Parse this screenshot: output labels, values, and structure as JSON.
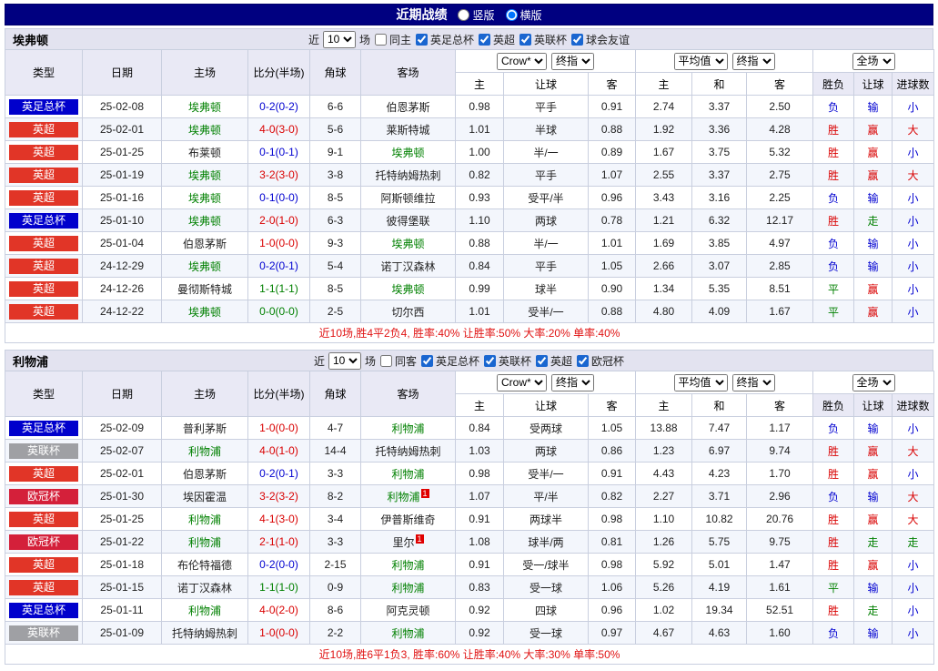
{
  "topbar": {
    "title": "近期战绩",
    "layout_options": [
      {
        "label": "竖版",
        "selected": false
      },
      {
        "label": "横版",
        "selected": true
      }
    ]
  },
  "filter_labels": {
    "recent_prefix": "近",
    "recent_count": "10",
    "recent_suffix": "场"
  },
  "selectors": {
    "bookmaker": "Crow*",
    "bookmaker_stage": "终指",
    "average": "平均值",
    "average_stage": "终指",
    "scope": "全场"
  },
  "columns": {
    "type": "类型",
    "date": "日期",
    "home": "主场",
    "score": "比分(半场)",
    "corner": "角球",
    "away": "客场",
    "hcp_home": "主",
    "hcp_line": "让球",
    "hcp_away": "客",
    "avg_home": "主",
    "avg_draw": "和",
    "avg_away": "客",
    "res_wdl": "胜负",
    "res_hcp": "让球",
    "res_goals": "进球数"
  },
  "colors": {
    "navy": "#000080",
    "red": "#D90000",
    "blue": "#0000D0",
    "green": "#008000",
    "summary": "#E01212",
    "comp": {
      "英足总杯": "#0000CC",
      "英超": "#E13527",
      "英联杯": "#9FA0A4",
      "欧冠杯": "#D4203A",
      "球会友谊": "#55AA55"
    }
  },
  "sections": [
    {
      "team": "埃弗顿",
      "same_side_label": "同主",
      "same_side_checked": false,
      "competitions": [
        {
          "label": "英足总杯",
          "checked": true
        },
        {
          "label": "英超",
          "checked": true
        },
        {
          "label": "英联杯",
          "checked": true
        },
        {
          "label": "球会友谊",
          "checked": true
        }
      ],
      "rows": [
        {
          "comp": "英足总杯",
          "date": "25-02-08",
          "home": "埃弗顿",
          "home_focus": true,
          "score": "0-2(0-2)",
          "score_color": "blue",
          "corner": "6-6",
          "away": "伯恩茅斯",
          "hcp": [
            "0.98",
            "平手",
            "0.91"
          ],
          "avg": [
            "2.74",
            "3.37",
            "2.50"
          ],
          "res": [
            [
              "负",
              "blue"
            ],
            [
              "输",
              "blue"
            ],
            [
              "小",
              "blue"
            ]
          ]
        },
        {
          "comp": "英超",
          "date": "25-02-01",
          "home": "埃弗顿",
          "home_focus": true,
          "score": "4-0(3-0)",
          "score_color": "red",
          "corner": "5-6",
          "away": "莱斯特城",
          "hcp": [
            "1.01",
            "半球",
            "0.88"
          ],
          "avg": [
            "1.92",
            "3.36",
            "4.28"
          ],
          "res": [
            [
              "胜",
              "red"
            ],
            [
              "赢",
              "red"
            ],
            [
              "大",
              "red"
            ]
          ]
        },
        {
          "comp": "英超",
          "date": "25-01-25",
          "home": "布莱顿",
          "score": "0-1(0-1)",
          "score_color": "blue",
          "corner": "9-1",
          "away": "埃弗顿",
          "away_focus": true,
          "hcp": [
            "1.00",
            "半/一",
            "0.89"
          ],
          "avg": [
            "1.67",
            "3.75",
            "5.32"
          ],
          "res": [
            [
              "胜",
              "red"
            ],
            [
              "赢",
              "red"
            ],
            [
              "小",
              "blue"
            ]
          ]
        },
        {
          "comp": "英超",
          "date": "25-01-19",
          "home": "埃弗顿",
          "home_focus": true,
          "score": "3-2(3-0)",
          "score_color": "red",
          "corner": "3-8",
          "away": "托特纳姆热刺",
          "hcp": [
            "0.82",
            "平手",
            "1.07"
          ],
          "avg": [
            "2.55",
            "3.37",
            "2.75"
          ],
          "res": [
            [
              "胜",
              "red"
            ],
            [
              "赢",
              "red"
            ],
            [
              "大",
              "red"
            ]
          ]
        },
        {
          "comp": "英超",
          "date": "25-01-16",
          "home": "埃弗顿",
          "home_focus": true,
          "score": "0-1(0-0)",
          "score_color": "blue",
          "corner": "8-5",
          "away": "阿斯顿维拉",
          "hcp": [
            "0.93",
            "受平/半",
            "0.96"
          ],
          "avg": [
            "3.43",
            "3.16",
            "2.25"
          ],
          "res": [
            [
              "负",
              "blue"
            ],
            [
              "输",
              "blue"
            ],
            [
              "小",
              "blue"
            ]
          ]
        },
        {
          "comp": "英足总杯",
          "date": "25-01-10",
          "home": "埃弗顿",
          "home_focus": true,
          "score": "2-0(1-0)",
          "score_color": "red",
          "corner": "6-3",
          "away": "彼得堡联",
          "hcp": [
            "1.10",
            "两球",
            "0.78"
          ],
          "avg": [
            "1.21",
            "6.32",
            "12.17"
          ],
          "res": [
            [
              "胜",
              "red"
            ],
            [
              "走",
              "green"
            ],
            [
              "小",
              "blue"
            ]
          ]
        },
        {
          "comp": "英超",
          "date": "25-01-04",
          "home": "伯恩茅斯",
          "score": "1-0(0-0)",
          "score_color": "red",
          "corner": "9-3",
          "away": "埃弗顿",
          "away_focus": true,
          "hcp": [
            "0.88",
            "半/一",
            "1.01"
          ],
          "avg": [
            "1.69",
            "3.85",
            "4.97"
          ],
          "res": [
            [
              "负",
              "blue"
            ],
            [
              "输",
              "blue"
            ],
            [
              "小",
              "blue"
            ]
          ]
        },
        {
          "comp": "英超",
          "date": "24-12-29",
          "home": "埃弗顿",
          "home_focus": true,
          "score": "0-2(0-1)",
          "score_color": "blue",
          "corner": "5-4",
          "away": "诺丁汉森林",
          "hcp": [
            "0.84",
            "平手",
            "1.05"
          ],
          "avg": [
            "2.66",
            "3.07",
            "2.85"
          ],
          "res": [
            [
              "负",
              "blue"
            ],
            [
              "输",
              "blue"
            ],
            [
              "小",
              "blue"
            ]
          ]
        },
        {
          "comp": "英超",
          "date": "24-12-26",
          "home": "曼彻斯特城",
          "score": "1-1(1-1)",
          "score_color": "green",
          "corner": "8-5",
          "away": "埃弗顿",
          "away_focus": true,
          "hcp": [
            "0.99",
            "球半",
            "0.90"
          ],
          "avg": [
            "1.34",
            "5.35",
            "8.51"
          ],
          "res": [
            [
              "平",
              "green"
            ],
            [
              "赢",
              "red"
            ],
            [
              "小",
              "blue"
            ]
          ]
        },
        {
          "comp": "英超",
          "date": "24-12-22",
          "home": "埃弗顿",
          "home_focus": true,
          "score": "0-0(0-0)",
          "score_color": "green",
          "corner": "2-5",
          "away": "切尔西",
          "hcp": [
            "1.01",
            "受半/一",
            "0.88"
          ],
          "avg": [
            "4.80",
            "4.09",
            "1.67"
          ],
          "res": [
            [
              "平",
              "green"
            ],
            [
              "赢",
              "red"
            ],
            [
              "小",
              "blue"
            ]
          ]
        }
      ],
      "summary": "近10场,胜4平2负4, 胜率:40% 让胜率:50% 大率:20% 单率:40%"
    },
    {
      "team": "利物浦",
      "same_side_label": "同客",
      "same_side_checked": false,
      "competitions": [
        {
          "label": "英足总杯",
          "checked": true
        },
        {
          "label": "英联杯",
          "checked": true
        },
        {
          "label": "英超",
          "checked": true
        },
        {
          "label": "欧冠杯",
          "checked": true
        }
      ],
      "rows": [
        {
          "comp": "英足总杯",
          "date": "25-02-09",
          "home": "普利茅斯",
          "score": "1-0(0-0)",
          "score_color": "red",
          "corner": "4-7",
          "away": "利物浦",
          "away_focus": true,
          "hcp": [
            "0.84",
            "受两球",
            "1.05"
          ],
          "avg": [
            "13.88",
            "7.47",
            "1.17"
          ],
          "res": [
            [
              "负",
              "blue"
            ],
            [
              "输",
              "blue"
            ],
            [
              "小",
              "blue"
            ]
          ]
        },
        {
          "comp": "英联杯",
          "date": "25-02-07",
          "home": "利物浦",
          "home_focus": true,
          "score": "4-0(1-0)",
          "score_color": "red",
          "corner": "14-4",
          "away": "托特纳姆热刺",
          "hcp": [
            "1.03",
            "两球",
            "0.86"
          ],
          "avg": [
            "1.23",
            "6.97",
            "9.74"
          ],
          "res": [
            [
              "胜",
              "red"
            ],
            [
              "赢",
              "red"
            ],
            [
              "大",
              "red"
            ]
          ]
        },
        {
          "comp": "英超",
          "date": "25-02-01",
          "home": "伯恩茅斯",
          "score": "0-2(0-1)",
          "score_color": "blue",
          "corner": "3-3",
          "away": "利物浦",
          "away_focus": true,
          "hcp": [
            "0.98",
            "受半/一",
            "0.91"
          ],
          "avg": [
            "4.43",
            "4.23",
            "1.70"
          ],
          "res": [
            [
              "胜",
              "red"
            ],
            [
              "赢",
              "red"
            ],
            [
              "小",
              "blue"
            ]
          ]
        },
        {
          "comp": "欧冠杯",
          "date": "25-01-30",
          "home": "埃因霍温",
          "score": "3-2(3-2)",
          "score_color": "red",
          "corner": "8-2",
          "away": "利物浦",
          "away_focus": true,
          "away_redcards": "1",
          "hcp": [
            "1.07",
            "平/半",
            "0.82"
          ],
          "avg": [
            "2.27",
            "3.71",
            "2.96"
          ],
          "res": [
            [
              "负",
              "blue"
            ],
            [
              "输",
              "blue"
            ],
            [
              "大",
              "red"
            ]
          ]
        },
        {
          "comp": "英超",
          "date": "25-01-25",
          "home": "利物浦",
          "home_focus": true,
          "score": "4-1(3-0)",
          "score_color": "red",
          "corner": "3-4",
          "away": "伊普斯维奇",
          "hcp": [
            "0.91",
            "两球半",
            "0.98"
          ],
          "avg": [
            "1.10",
            "10.82",
            "20.76"
          ],
          "res": [
            [
              "胜",
              "red"
            ],
            [
              "赢",
              "red"
            ],
            [
              "大",
              "red"
            ]
          ]
        },
        {
          "comp": "欧冠杯",
          "date": "25-01-22",
          "home": "利物浦",
          "home_focus": true,
          "score": "2-1(1-0)",
          "score_color": "red",
          "corner": "3-3",
          "away": "里尔",
          "away_redcards": "1",
          "hcp": [
            "1.08",
            "球半/两",
            "0.81"
          ],
          "avg": [
            "1.26",
            "5.75",
            "9.75"
          ],
          "res": [
            [
              "胜",
              "red"
            ],
            [
              "走",
              "green"
            ],
            [
              "走",
              "green"
            ]
          ]
        },
        {
          "comp": "英超",
          "date": "25-01-18",
          "home": "布伦特福德",
          "score": "0-2(0-0)",
          "score_color": "blue",
          "corner": "2-15",
          "away": "利物浦",
          "away_focus": true,
          "hcp": [
            "0.91",
            "受一/球半",
            "0.98"
          ],
          "avg": [
            "5.92",
            "5.01",
            "1.47"
          ],
          "res": [
            [
              "胜",
              "red"
            ],
            [
              "赢",
              "red"
            ],
            [
              "小",
              "blue"
            ]
          ]
        },
        {
          "comp": "英超",
          "date": "25-01-15",
          "home": "诺丁汉森林",
          "score": "1-1(1-0)",
          "score_color": "green",
          "corner": "0-9",
          "away": "利物浦",
          "away_focus": true,
          "hcp": [
            "0.83",
            "受一球",
            "1.06"
          ],
          "avg": [
            "5.26",
            "4.19",
            "1.61"
          ],
          "res": [
            [
              "平",
              "green"
            ],
            [
              "输",
              "blue"
            ],
            [
              "小",
              "blue"
            ]
          ]
        },
        {
          "comp": "英足总杯",
          "date": "25-01-11",
          "home": "利物浦",
          "home_focus": true,
          "score": "4-0(2-0)",
          "score_color": "red",
          "corner": "8-6",
          "away": "阿克灵顿",
          "hcp": [
            "0.92",
            "四球",
            "0.96"
          ],
          "avg": [
            "1.02",
            "19.34",
            "52.51"
          ],
          "res": [
            [
              "胜",
              "red"
            ],
            [
              "走",
              "green"
            ],
            [
              "小",
              "blue"
            ]
          ]
        },
        {
          "comp": "英联杯",
          "date": "25-01-09",
          "home": "托特纳姆热刺",
          "score": "1-0(0-0)",
          "score_color": "red",
          "corner": "2-2",
          "away": "利物浦",
          "away_focus": true,
          "hcp": [
            "0.92",
            "受一球",
            "0.97"
          ],
          "avg": [
            "4.67",
            "4.63",
            "1.60"
          ],
          "res": [
            [
              "负",
              "blue"
            ],
            [
              "输",
              "blue"
            ],
            [
              "小",
              "blue"
            ]
          ]
        }
      ],
      "summary": "近10场,胜6平1负3, 胜率:60% 让胜率:40% 大率:30% 单率:50%"
    }
  ]
}
